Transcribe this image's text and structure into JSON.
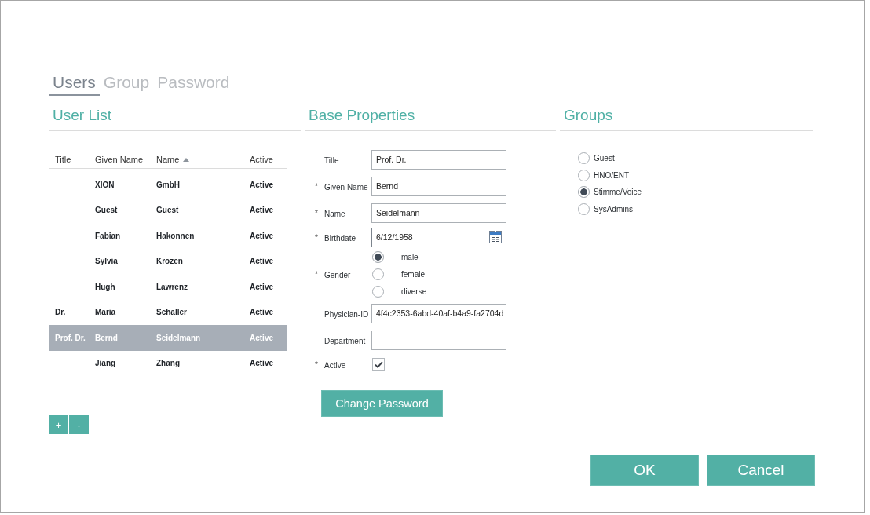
{
  "tabs": [
    {
      "label": "Users",
      "selected": true
    },
    {
      "label": "Group",
      "selected": false
    },
    {
      "label": "Password",
      "selected": false
    }
  ],
  "user_list": {
    "heading": "User List",
    "columns": [
      {
        "label": "Title",
        "sorted": false
      },
      {
        "label": "Given Name",
        "sorted": false
      },
      {
        "label": "Name",
        "sorted": true
      },
      {
        "label": "Active",
        "sorted": false
      }
    ],
    "rows": [
      {
        "given_name": "XION",
        "name": "GmbH",
        "active": "Active",
        "selected": false
      },
      {
        "given_name": "Guest",
        "name": "Guest",
        "active": "Active",
        "selected": false
      },
      {
        "given_name": "Fabian",
        "name": "Hakonnen",
        "active": "Active",
        "selected": false
      },
      {
        "given_name": "Sylvia",
        "name": "Krozen",
        "active": "Active",
        "selected": false
      },
      {
        "given_name": "Hugh",
        "name": "Lawrenz",
        "active": "Active",
        "selected": false
      },
      {
        "title": "Dr.",
        "given_name": "Maria",
        "name": "Schaller",
        "active": "Active",
        "selected": false
      },
      {
        "title": "Prof. Dr.",
        "given_name": "Bernd",
        "name": "Seidelmann",
        "active": "Active",
        "selected": true
      },
      {
        "given_name": "Jiang",
        "name": "Zhang",
        "active": "Active",
        "selected": false
      }
    ],
    "buttons": [
      "+",
      "-"
    ]
  },
  "base_properties": {
    "heading": "Base Properties",
    "fields": [
      {
        "kind": "text",
        "label": "Title",
        "value": "Prof. Dr."
      },
      {
        "kind": "text",
        "mark": "*",
        "label": "Given Name",
        "value": "Bernd"
      },
      {
        "kind": "text",
        "mark": "*",
        "label": "Name",
        "value": "Seidelmann"
      },
      {
        "kind": "date",
        "mark": "*",
        "label": "Birthdate",
        "value": "6/12/1958"
      },
      {
        "kind": "radio",
        "mark": "*",
        "label": "Gender",
        "options": [
          {
            "label": "male",
            "selected": true
          },
          {
            "label": "female",
            "selected": false
          },
          {
            "label": "diverse",
            "selected": false
          }
        ]
      },
      {
        "kind": "text",
        "label": "Physician-ID",
        "value": "4f4c2353-6abd-40af-b4a9-fa2704d"
      },
      {
        "kind": "text",
        "label": "Department"
      },
      {
        "kind": "checkbox",
        "mark": "*",
        "label": "Active",
        "checked": true
      }
    ],
    "button": "Change Password"
  },
  "groups": {
    "heading": "Groups",
    "options": [
      {
        "label": "Guest",
        "selected": false
      },
      {
        "label": "HNO/ENT",
        "selected": false
      },
      {
        "label": "Stimme/Voice",
        "selected": true
      },
      {
        "label": "SysAdmins",
        "selected": false
      }
    ]
  },
  "dialog_buttons": [
    "OK",
    "Cancel"
  ]
}
